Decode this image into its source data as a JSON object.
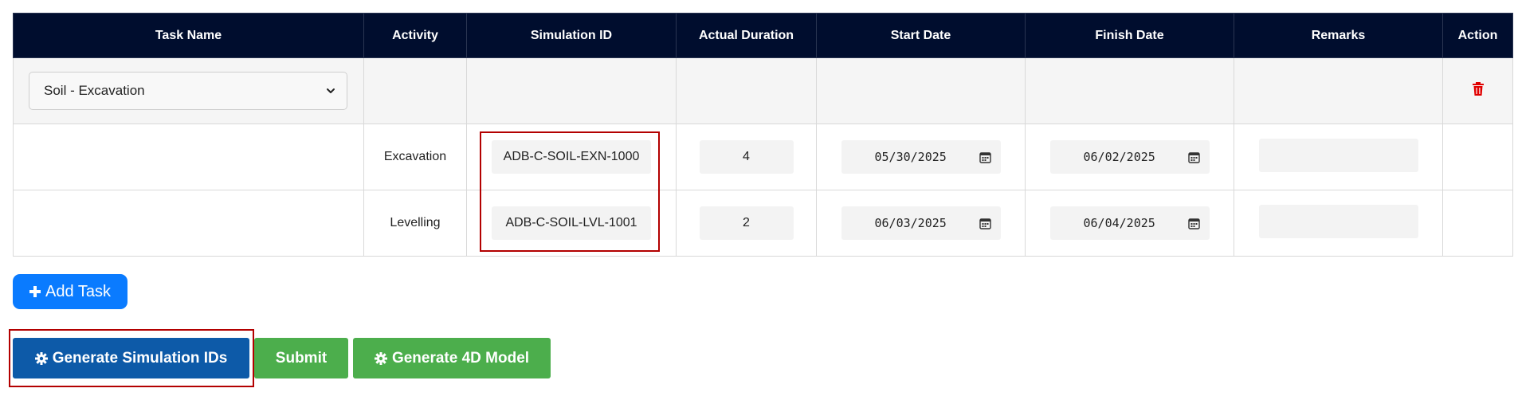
{
  "table": {
    "headers": [
      "Task Name",
      "Activity",
      "Simulation ID",
      "Actual Duration",
      "Start Date",
      "Finish Date",
      "Remarks",
      "Action"
    ],
    "task_select": {
      "value": "Soil - Excavation"
    },
    "rows": [
      {
        "activity": "Excavation",
        "simulation_id": "ADB-C-SOIL-EXN-1000",
        "duration": "4",
        "start_date": "05/30/2025",
        "finish_date": "06/02/2025",
        "remarks": ""
      },
      {
        "activity": "Levelling",
        "simulation_id": "ADB-C-SOIL-LVL-1001",
        "duration": "2",
        "start_date": "06/03/2025",
        "finish_date": "06/04/2025",
        "remarks": ""
      }
    ]
  },
  "buttons": {
    "add_task": "Add Task",
    "generate_ids": "Generate Simulation IDs",
    "submit": "Submit",
    "generate_4d": "Generate 4D Model"
  },
  "icons": {
    "plus": "plus-icon",
    "gear": "gear-icon",
    "trash": "trash-icon",
    "calendar": "calendar-icon",
    "chevron": "chevron-down-icon"
  },
  "colors": {
    "header_bg": "#000d2e",
    "primary_blue": "#0a7bff",
    "dark_blue": "#0d5aa8",
    "green": "#4cae4c",
    "highlight_red": "#b30000",
    "trash_red": "#e00000"
  }
}
